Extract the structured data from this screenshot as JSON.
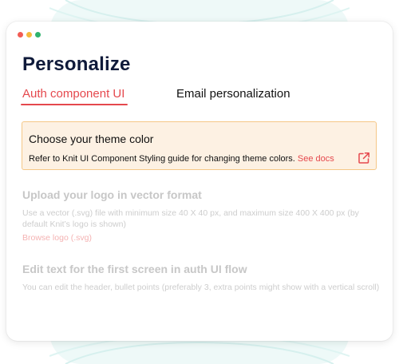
{
  "window": {
    "traffic_lights": [
      "#f25c54",
      "#f6b93b",
      "#2fb36d"
    ]
  },
  "page": {
    "title": "Personalize"
  },
  "tabs": [
    {
      "label": "Auth component UI",
      "active": true
    },
    {
      "label": "Email personalization",
      "active": false
    }
  ],
  "callout": {
    "title": "Choose your theme color",
    "text": "Refer to Knit UI Component Styling guide for changing theme colors.",
    "link_label": "See docs",
    "icon": "external-link-icon"
  },
  "logo_section": {
    "title": "Upload your logo in vector format",
    "description": "Use a vector (.svg) file with minimum size 40 X 40 px, and maximum size 400 X 400 px (by default Knit’s logo is shown)",
    "link_label": "Browse logo  (.svg)"
  },
  "text_section": {
    "title": "Edit text for the first screen in auth UI flow",
    "description": "You can edit the header, bullet points (preferably 3, extra points might show with a vertical scroll)"
  },
  "colors": {
    "accent": "#e5484d",
    "callout_bg": "#fdf1e3",
    "callout_border": "#f5c787",
    "title": "#0f1a3a"
  }
}
